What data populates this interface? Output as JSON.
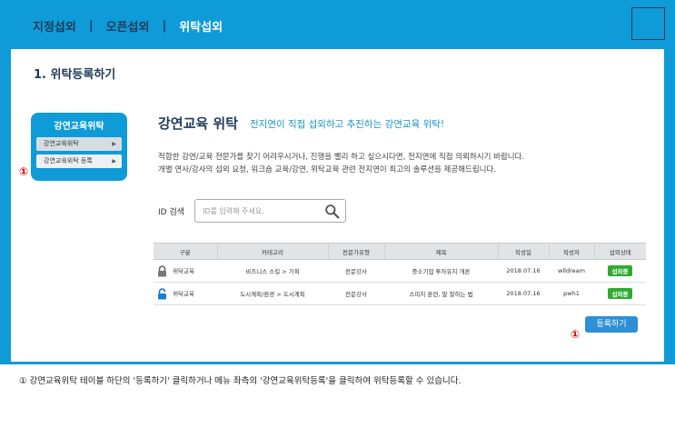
{
  "nav": {
    "tabs": [
      {
        "label": "지정섭외"
      },
      {
        "label": "오픈섭외"
      },
      {
        "label": "위탁섭외"
      }
    ],
    "separator": "|",
    "active_tab": "위탁섭외"
  },
  "page": {
    "title": "1. 위탁등록하기"
  },
  "side_menu": {
    "title": "강연교육위탁",
    "items": [
      {
        "label": "강연교육위탁",
        "arrow": "▶"
      },
      {
        "label": "강연교육위탁 등록",
        "arrow": "▶"
      }
    ]
  },
  "markers": {
    "side": "①",
    "register": "①"
  },
  "section": {
    "title": "강연교육 위탁",
    "subtitle": "전지연이 직접 섭외하고 추진하는 강연교육 위탁!",
    "desc_line1": "적합한 강연/교육 전문가를 찾기 어려우시거나, 진행을 빨리 하고 싶으시다면, 전지연에 직접 의뢰하시기 바랍니다.",
    "desc_line2": "개별 연사/강사의 섭외 요청, 워크숍 교육/강연, 위탁교육 관련 전지연이 최고의 솔루션을 제공해드립니다."
  },
  "search": {
    "label": "ID 검색",
    "placeholder": "ID를 입력해 주세요.",
    "value": ""
  },
  "table": {
    "headers": [
      "구분",
      "카테고리",
      "전문가유형",
      "제목",
      "작성일",
      "작성자",
      "섭외상태"
    ],
    "rows": [
      {
        "kind": "위탁교육",
        "category": "비즈니스 스킬 > 기획",
        "type": "전문강사",
        "subject": "중소기업 투자유치 개론",
        "date": "2018.07.16",
        "author": "wlldream",
        "status": "섭외중",
        "lock": "closed"
      },
      {
        "kind": "위탁교육",
        "category": "도시계획/환경 > 도시계획",
        "type": "전문강사",
        "subject": "스피치 훈련, 말 잘하는 법",
        "date": "2018.07.16",
        "author": "pwh1",
        "status": "섭외중",
        "lock": "open"
      }
    ]
  },
  "register_button": {
    "label": "등록하기"
  },
  "footer": {
    "note": "① 강연교육위탁 테이블 하단의 '등록하기' 클릭하거나 메뉴 좌측의 '강연교육위탁등록'을 클릭하여 위탁등록할 수 있습니다."
  },
  "colors": {
    "brand_blue": "#0f9bd7",
    "navy": "#1f3b57",
    "status_green": "#2eab30",
    "button_blue": "#2d8fd6",
    "marker_red": "#d40000"
  },
  "icons": {
    "search": "search-icon",
    "lock_closed": "lock-closed-icon",
    "lock_open": "lock-open-icon",
    "corner": "menu-square-icon"
  }
}
